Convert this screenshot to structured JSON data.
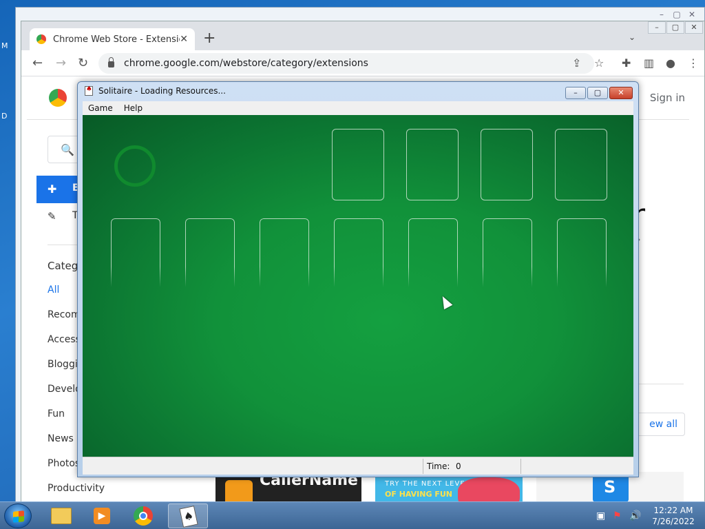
{
  "desktop": {
    "left_letters": [
      "M",
      "D"
    ]
  },
  "bg_window": {
    "controls": [
      "–",
      "▢",
      "✕"
    ]
  },
  "chrome": {
    "tab_title": "Chrome Web Store - Extensions",
    "tab_close": "✕",
    "new_tab": "+",
    "tab_menu": "⌄",
    "window_controls": [
      "–",
      "▢",
      "✕"
    ],
    "url": "chrome.google.com/webstore/category/extensions",
    "back": "←",
    "forward": "→",
    "reload": "↻",
    "share": "⇪",
    "bookmark": "☆",
    "extensions": "✚",
    "sidepanel": "▥",
    "profile": "●",
    "menu": "⋮"
  },
  "page": {
    "signin": "Sign in",
    "search_glyph": "🔍",
    "side_extensions_letter": "E",
    "side_themes_letter": "T",
    "categories_heading": "Catego",
    "categories": [
      "All",
      "Recom",
      "Access",
      "Bloggin",
      "Develo",
      "Fun",
      "News &",
      "Photos",
      "Productivity"
    ],
    "active_category": "All",
    "right_fragment": "r",
    "carousel_next": "›",
    "view_all": "ew all",
    "tile_callername": "CallerName",
    "tile_fun_line1": "TRY THE NEXT LEVEL",
    "tile_fun_line2": "OF HAVING FUN",
    "tile_s": "S"
  },
  "solitaire": {
    "title": "Solitaire - Loading Resources...",
    "menu": [
      "Game",
      "Help"
    ],
    "controls": {
      "minimize": "–",
      "maximize": "▢",
      "close": "✕"
    },
    "status": {
      "time_label": "Time:",
      "time_value": "0"
    },
    "foundations": 4,
    "tableau_columns": 7
  },
  "taskbar": {
    "clock_time": "12:22 AM",
    "clock_date": "7/26/2022",
    "tray": [
      "▣",
      "⚑",
      "🔊"
    ],
    "items": [
      "file-explorer",
      "media-player",
      "chrome",
      "solitaire"
    ],
    "active_item": "solitaire"
  }
}
